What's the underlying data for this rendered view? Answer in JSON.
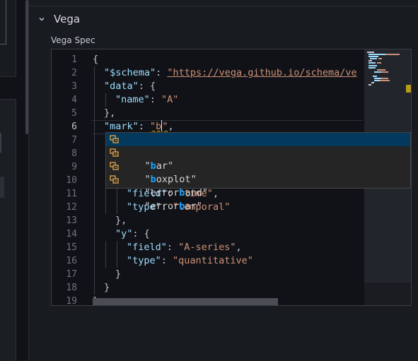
{
  "section": {
    "title": "Vega"
  },
  "editor_field": {
    "label": "Vega Spec"
  },
  "editor": {
    "line_numbers": [
      "1",
      "2",
      "3",
      "4",
      "5",
      "6",
      "7",
      "8",
      "9",
      "10",
      "11",
      "12",
      "13",
      "14",
      "15",
      "16",
      "17",
      "18",
      "19"
    ],
    "active_line": 6,
    "lines": {
      "l1": "{",
      "l2_key": "\"$schema\"",
      "l2_val": "\"https://vega.github.io/schema/ve",
      "l3_key": "\"data\"",
      "l3_rest": ": {",
      "l4_key": "\"name\"",
      "l4_val": "\"A\"",
      "l5": "},",
      "l6_key": "\"mark\"",
      "l6_val_a": "\"b",
      "l6_val_b": "\"",
      "l6_rest": ",",
      "l7_frag": "\"",
      "l8_frag": "\"",
      "l9_frag": "\"",
      "l11_key": "\"field\"",
      "l11_val": "\"time\"",
      "l12_key": "\"type\"",
      "l12_val": "\"temporal\"",
      "l13": "},",
      "l14_key": "\"y\"",
      "l14_rest": ": {",
      "l15_key": "\"field\"",
      "l15_val": "\"A-series\"",
      "l16_key": "\"type\"",
      "l16_val": "\"quantitative\"",
      "l17": "}",
      "l18": "}",
      "l19": "}"
    }
  },
  "suggestions": [
    {
      "pre": "\"",
      "match": "b",
      "post": "ar\"",
      "selected": true
    },
    {
      "pre": "\"",
      "match": "b",
      "post": "oxplot\"",
      "selected": false
    },
    {
      "pre": "\"error",
      "match": "b",
      "post": "and\"",
      "selected": false
    },
    {
      "pre": "\"error",
      "match": "b",
      "post": "ar\"",
      "selected": false
    }
  ],
  "icons": {
    "section_toggle": "chevron-down-icon",
    "suggestion_kind": "enum-value-icon"
  },
  "colors": {
    "key": "#9cdcfe",
    "string": "#ce9178",
    "match_highlight": "#18a3ff",
    "selected_suggestion_bg": "#04395e",
    "warning_squiggle": "#cca700"
  }
}
